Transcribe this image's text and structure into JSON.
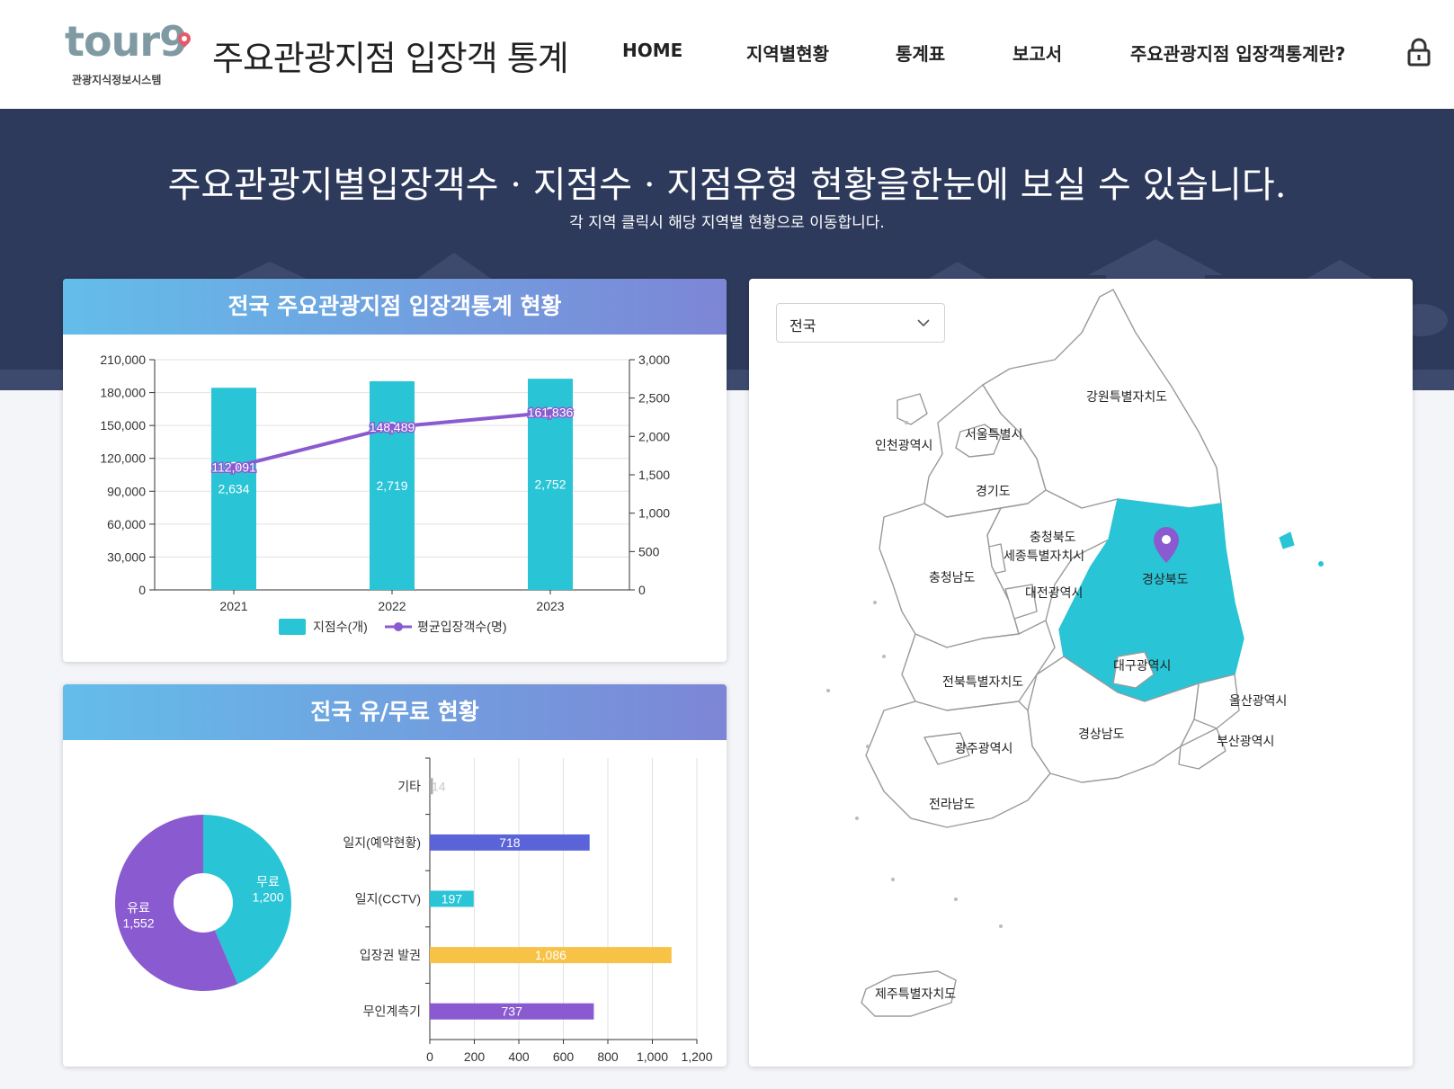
{
  "header": {
    "logo_text": "tour9",
    "logo_sub": "관광지식정보시스템",
    "site_title": "주요관광지점 입장객 통계",
    "nav": [
      "HOME",
      "지역별현황",
      "통계표",
      "보고서",
      "주요관광지점 입장객통계란?"
    ]
  },
  "banner": {
    "title": "주요관광지별입장객수 · 지점수 · 지점유형 현황을한눈에 보실 수 있습니다.",
    "subtitle": "각 지역 클릭시 해당 지역별 현황으로 이동합니다."
  },
  "card1": {
    "title": "전국 주요관광지점 입장객통계 현황"
  },
  "card2": {
    "title": "전국 유/무료 현황"
  },
  "map": {
    "select_value": "전국",
    "selected_region": "경상북도",
    "highlight_color": "#29c4d6",
    "regions": [
      "강원특별자치도",
      "서울특별시",
      "인천광역시",
      "경기도",
      "충청북도",
      "세종특별자치시",
      "충청남도",
      "대전광역시",
      "경상북도",
      "대구광역시",
      "전북특별자치도",
      "울산광역시",
      "경상남도",
      "부산광역시",
      "광주광역시",
      "전라남도",
      "제주특별자치도"
    ]
  },
  "chart_data": [
    {
      "type": "bar",
      "categories": [
        "2021",
        "2022",
        "2023"
      ],
      "series": [
        {
          "name": "지점수(개)",
          "type": "bar",
          "axis": "right",
          "values": [
            2634,
            2719,
            2752
          ],
          "color": "#29c4d6"
        },
        {
          "name": "평균입장객수(명)",
          "type": "line",
          "axis": "left",
          "values": [
            112091,
            148489,
            161836
          ],
          "color": "#8a5bd0"
        }
      ],
      "y_left": {
        "min": 0,
        "max": 210000,
        "ticks": [
          "0",
          "30,000",
          "60,000",
          "90,000",
          "120,000",
          "150,000",
          "180,000",
          "210,000"
        ]
      },
      "y_right": {
        "min": 0,
        "max": 3000,
        "ticks": [
          "0",
          "500",
          "1,000",
          "1,500",
          "2,000",
          "2,500",
          "3,000"
        ]
      },
      "bar_labels": [
        "2,634",
        "2,719",
        "2,752"
      ],
      "line_labels": [
        "112,091",
        "148,489",
        "161,836"
      ],
      "legend": "bottom",
      "grid": true
    },
    {
      "type": "pie",
      "donut": true,
      "slices": [
        {
          "name": "무료",
          "value": 1200,
          "label": "1,200",
          "color": "#29c4d6"
        },
        {
          "name": "유료",
          "value": 1552,
          "label": "1,552",
          "color": "#8a5bd0"
        }
      ]
    },
    {
      "type": "bar",
      "orientation": "horizontal",
      "categories": [
        "기타",
        "일지(예약현황)",
        "일지(CCTV)",
        "입장권 발권",
        "무인계측기"
      ],
      "values": [
        14,
        718,
        197,
        1086,
        737
      ],
      "value_labels": [
        "14",
        "718",
        "197",
        "1,086",
        "737"
      ],
      "colors": [
        "#aaaaaa",
        "#5b63d9",
        "#29c4d6",
        "#f8c246",
        "#8a5bd0"
      ],
      "x_range": [
        0,
        1200
      ],
      "x_ticks": [
        "0",
        "200",
        "400",
        "600",
        "800",
        "1,000",
        "1,200"
      ],
      "grid": true
    }
  ]
}
